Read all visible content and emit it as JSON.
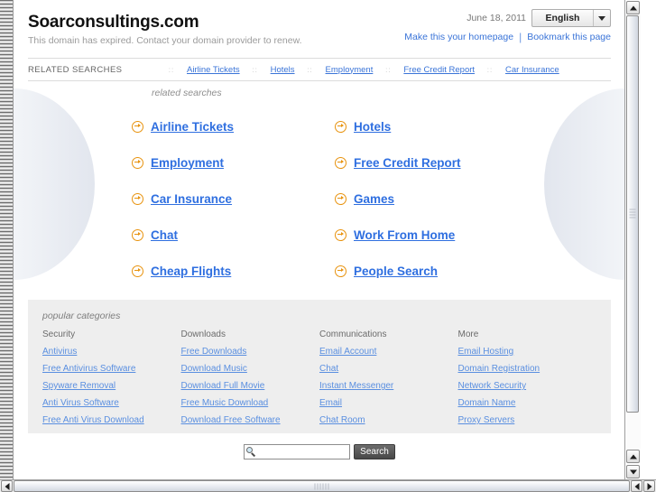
{
  "header": {
    "site_title": "Soarconsultings.com",
    "expiry_note": "This domain has expired. Contact your domain provider to renew.",
    "date": "June 18, 2011",
    "language_selected": "English",
    "make_homepage": "Make this your homepage",
    "bookmark_page": "Bookmark this page",
    "separator": "|"
  },
  "related_bar": {
    "label": "RELATED SEARCHES",
    "separator": "::",
    "links": [
      "Airline Tickets",
      "Hotels",
      "Employment",
      "Free Credit Report",
      "Car Insurance"
    ]
  },
  "related_searches": {
    "heading": "related searches",
    "links": [
      "Airline Tickets",
      "Hotels",
      "Employment",
      "Free Credit Report",
      "Car Insurance",
      "Games",
      "Chat",
      "Work From Home",
      "Cheap Flights",
      "People Search"
    ]
  },
  "popular_categories": {
    "heading": "popular categories",
    "columns": [
      {
        "title": "Security",
        "links": [
          "Antivirus",
          "Free Antivirus Software",
          "Spyware Removal",
          "Anti Virus Software",
          "Free Anti Virus Download"
        ]
      },
      {
        "title": "Downloads",
        "links": [
          "Free Downloads",
          "Download Music",
          "Download Full Movie",
          "Free Music Download",
          "Download Free Software"
        ]
      },
      {
        "title": "Communications",
        "links": [
          "Email Account",
          "Chat",
          "Instant Messenger",
          "Email",
          "Chat Room"
        ]
      },
      {
        "title": "More",
        "links": [
          "Email Hosting",
          "Domain Registration",
          "Network Security",
          "Domain Name",
          "Proxy Servers"
        ]
      }
    ]
  },
  "search": {
    "value": "",
    "placeholder": "",
    "button_label": "Search",
    "icon": "magnifier-icon"
  },
  "colors": {
    "link_blue": "#2f6fe0",
    "nav_link_blue": "#3a74d8",
    "category_link_blue": "#5a8fe0",
    "bullet_orange": "#e8930f",
    "panel_grey": "#eeeeee",
    "muted_text": "#9b9b9b"
  },
  "browser_chrome": {
    "vertical_scrollbar": "vertical-scrollbar",
    "horizontal_scrollbar": "horizontal-scrollbar"
  }
}
